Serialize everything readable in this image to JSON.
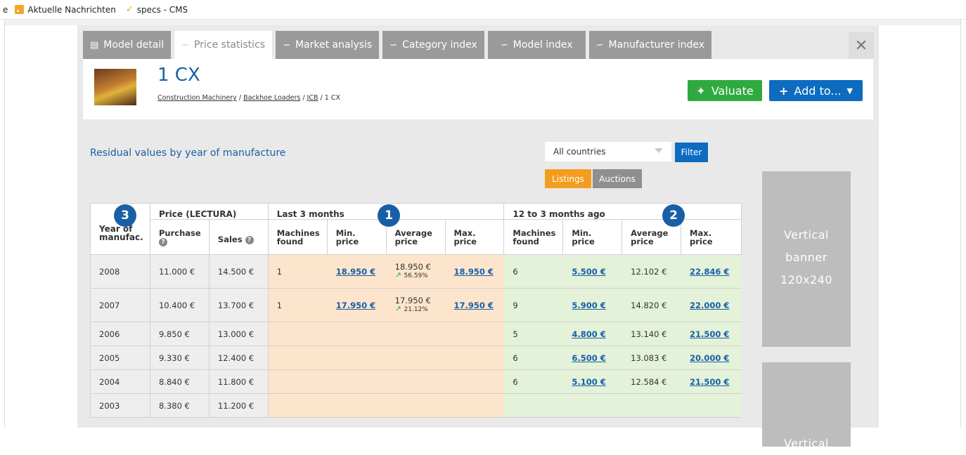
{
  "bookmarks": {
    "cut": "e",
    "news": "Aktuelle Nachrichten",
    "cms": "specs - CMS"
  },
  "tabs": [
    {
      "label": "Model detail",
      "icon": "table-icon"
    },
    {
      "label": "Price statistics",
      "icon": "chart-icon"
    },
    {
      "label": "Market analysis",
      "icon": "chart-icon"
    },
    {
      "label": "Category index",
      "icon": "chart-icon"
    },
    {
      "label": "Model index",
      "icon": "chart-icon"
    },
    {
      "label": "Manufacturer index",
      "icon": "chart-icon"
    }
  ],
  "header": {
    "title": "1 CX",
    "breadcrumb": [
      "Construction Machinery",
      "Backhoe Loaders",
      "JCB",
      "1 CX"
    ],
    "valuate": "Valuate",
    "add_to": "Add to..."
  },
  "section_title": "Residual values by year of manufacture",
  "filter": {
    "country": "All countries",
    "button": "Filter",
    "listings": "Listings",
    "auctions": "Auctions"
  },
  "banner": {
    "label": "Vertical\nbanner\n120x240",
    "label2": "Vertical"
  },
  "badges": {
    "b1": "1",
    "b2": "2",
    "b3": "3"
  },
  "table": {
    "groups": {
      "year": "Year of manufac.",
      "price": "Price (LECTURA)",
      "last3": "Last 3 months",
      "ago": "12 to 3 months ago"
    },
    "cols": {
      "purchase": "Purchase",
      "sales": "Sales",
      "found": "Machines found",
      "min": "Min. price",
      "avg": "Average price",
      "max": "Max. price"
    },
    "rows": [
      {
        "year": "2008",
        "purchase": "11.000 €",
        "sales": "14.500 €",
        "l_found": "1",
        "l_min": "18.950 €",
        "l_avg": "18.950 €",
        "l_pct": "56.59%",
        "l_max": "18.950 €",
        "a_found": "6",
        "a_min": "5.500 €",
        "a_avg": "12.102 €",
        "a_max": "22.846 €"
      },
      {
        "year": "2007",
        "purchase": "10.400 €",
        "sales": "13.700 €",
        "l_found": "1",
        "l_min": "17.950 €",
        "l_avg": "17.950 €",
        "l_pct": "21.12%",
        "l_max": "17.950 €",
        "a_found": "9",
        "a_min": "5.900 €",
        "a_avg": "14.820 €",
        "a_max": "22.000 €"
      },
      {
        "year": "2006",
        "purchase": "9.850 €",
        "sales": "13.000 €",
        "a_found": "5",
        "a_min": "4.800 €",
        "a_avg": "13.140 €",
        "a_max": "21.500 €"
      },
      {
        "year": "2005",
        "purchase": "9.330 €",
        "sales": "12.400 €",
        "a_found": "6",
        "a_min": "6.500 €",
        "a_avg": "13.083 €",
        "a_max": "20.000 €"
      },
      {
        "year": "2004",
        "purchase": "8.840 €",
        "sales": "11.800 €",
        "a_found": "6",
        "a_min": "5.100 €",
        "a_avg": "12.584 €",
        "a_max": "21.500 €"
      },
      {
        "year": "2003",
        "purchase": "8.380 €",
        "sales": "11.200 €"
      }
    ]
  }
}
